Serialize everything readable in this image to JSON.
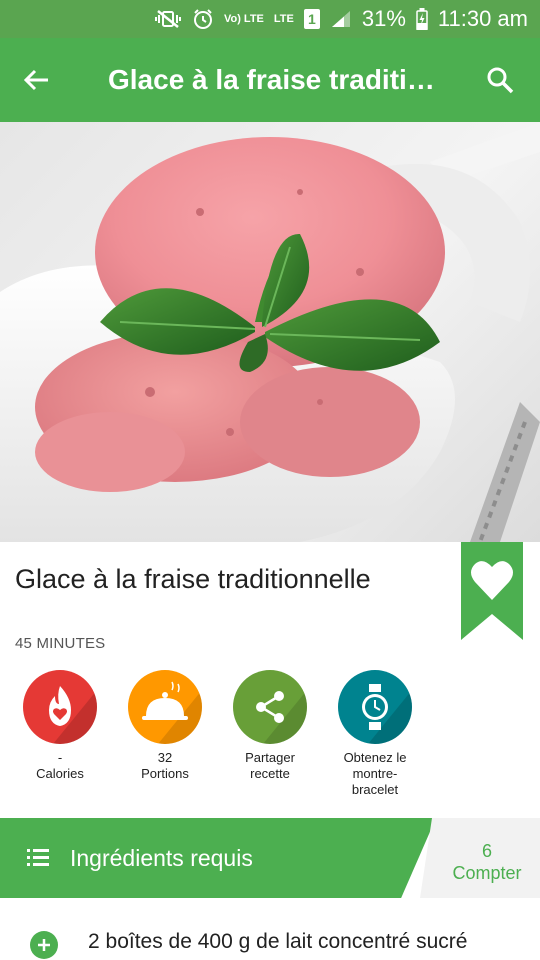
{
  "status_bar": {
    "volte_label": "Vo) LTE",
    "lte_label": "LTE",
    "sim_label": "1",
    "battery": "31%",
    "time": "11:30 am"
  },
  "app_bar": {
    "title": "Glace à la fraise traditi…"
  },
  "recipe": {
    "title": "Glace à la fraise traditionnelle",
    "time": "45 MINUTES"
  },
  "actions": [
    {
      "line1": "-",
      "line2": "Calories",
      "line3": "",
      "color": "#e53935",
      "icon": "calories-heart-icon"
    },
    {
      "line1": "32",
      "line2": "Portions",
      "line3": "",
      "color": "#ff9800",
      "icon": "serving-cloche-icon"
    },
    {
      "line1": "Partager",
      "line2": "recette",
      "line3": "",
      "color": "#689f38",
      "icon": "share-icon"
    },
    {
      "line1": "Obtenez le",
      "line2": "montre-",
      "line3": "bracelet",
      "color": "#00838f",
      "icon": "smartwatch-icon"
    }
  ],
  "ingredients_band": {
    "title": "Ingrédients requis",
    "count": "6",
    "count_label": "Compter"
  },
  "ingredients": [
    {
      "text": "2 boîtes de 400 g de lait concentré sucré"
    }
  ],
  "colors": {
    "primary": "#4caf50",
    "status_bar": "#5aa550",
    "bookmark": "#4caf50"
  }
}
